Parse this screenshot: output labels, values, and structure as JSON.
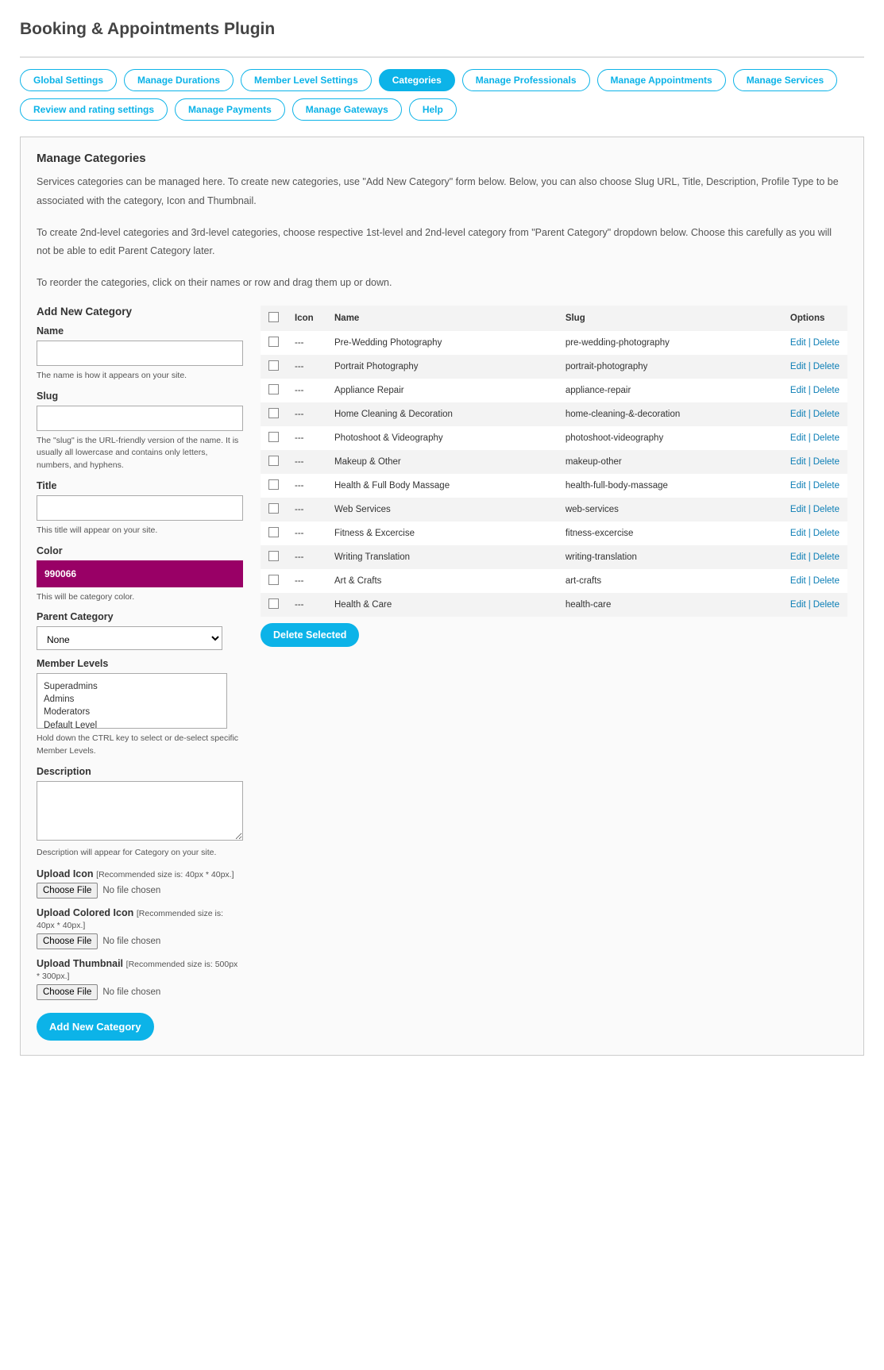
{
  "page_title": "Booking & Appointments Plugin",
  "tabs": [
    {
      "label": "Global Settings",
      "active": false
    },
    {
      "label": "Manage Durations",
      "active": false
    },
    {
      "label": "Member Level Settings",
      "active": false
    },
    {
      "label": "Categories",
      "active": true
    },
    {
      "label": "Manage Professionals",
      "active": false
    },
    {
      "label": "Manage Appointments",
      "active": false
    },
    {
      "label": "Manage Services",
      "active": false
    },
    {
      "label": "Review and rating settings",
      "active": false
    },
    {
      "label": "Manage Payments",
      "active": false
    },
    {
      "label": "Manage Gateways",
      "active": false
    },
    {
      "label": "Help",
      "active": false
    }
  ],
  "panel": {
    "title": "Manage Categories",
    "desc1": "Services categories can be managed here. To create new categories, use \"Add New Category\" form below. Below, you can also choose Slug URL, Title, Description, Profile Type to be associated with the category, Icon and Thumbnail.",
    "desc2": "To create 2nd-level categories and 3rd-level categories, choose respective 1st-level and 2nd-level category from \"Parent Category\" dropdown below. Choose this carefully as you will not be able to edit Parent Category later.",
    "desc3": "To reorder the categories, click on their names or row and drag them up or down."
  },
  "form": {
    "section_title": "Add New Category",
    "name_label": "Name",
    "name_hint": "The name is how it appears on your site.",
    "slug_label": "Slug",
    "slug_hint": "The \"slug\" is the URL-friendly version of the name. It is usually all lowercase and contains only letters, numbers, and hyphens.",
    "title_label": "Title",
    "title_hint": "This title will appear on your site.",
    "color_label": "Color",
    "color_value": "990066",
    "color_hint": "This will be category color.",
    "parent_label": "Parent Category",
    "parent_selected": "None",
    "member_levels_label": "Member Levels",
    "member_levels": [
      "Superadmins",
      "Admins",
      "Moderators",
      "Default Level"
    ],
    "member_levels_hint": "Hold down the CTRL key to select or de-select specific Member Levels.",
    "description_label": "Description",
    "description_hint": "Description will appear for Category on your site.",
    "upload_icon_label": "Upload Icon",
    "upload_icon_rec": "[Recommended size is: 40px * 40px.]",
    "upload_colored_label": "Upload Colored Icon",
    "upload_colored_rec": "[Recommended size is: 40px * 40px.]",
    "upload_thumb_label": "Upload Thumbnail",
    "upload_thumb_rec": "[Recommended size is: 500px * 300px.]",
    "choose_file": "Choose File",
    "no_file": "No file chosen",
    "submit": "Add New Category"
  },
  "table": {
    "headers": {
      "icon": "Icon",
      "name": "Name",
      "slug": "Slug",
      "options": "Options"
    },
    "icon_placeholder": "---",
    "edit": "Edit",
    "delete": "Delete",
    "delete_selected": "Delete Selected",
    "rows": [
      {
        "name": "Pre-Wedding Photography",
        "slug": "pre-wedding-photography"
      },
      {
        "name": "Portrait Photography",
        "slug": "portrait-photography"
      },
      {
        "name": "Appliance Repair",
        "slug": "appliance-repair"
      },
      {
        "name": "Home Cleaning & Decoration",
        "slug": "home-cleaning-&-decoration"
      },
      {
        "name": "Photoshoot & Videography",
        "slug": "photoshoot-videography"
      },
      {
        "name": "Makeup & Other",
        "slug": "makeup-other"
      },
      {
        "name": "Health & Full Body Massage",
        "slug": "health-full-body-massage"
      },
      {
        "name": "Web Services",
        "slug": "web-services"
      },
      {
        "name": "Fitness & Excercise",
        "slug": "fitness-excercise"
      },
      {
        "name": "Writing Translation",
        "slug": "writing-translation"
      },
      {
        "name": "Art & Crafts",
        "slug": "art-crafts"
      },
      {
        "name": "Health & Care",
        "slug": "health-care"
      }
    ]
  }
}
